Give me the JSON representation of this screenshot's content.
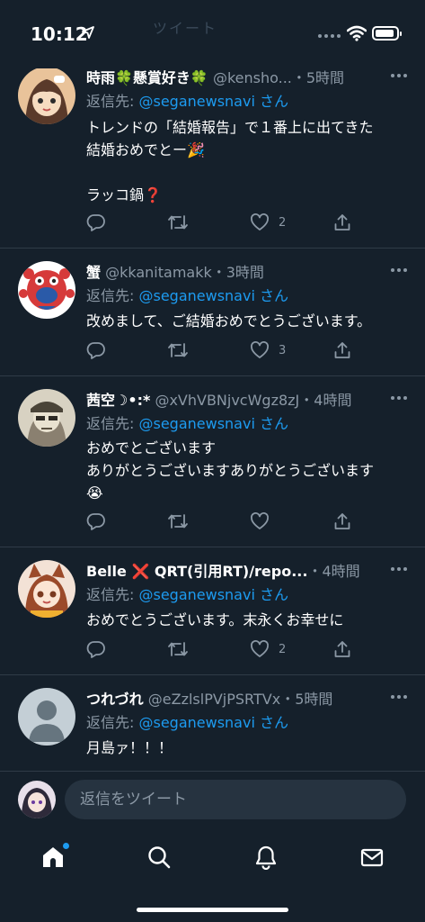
{
  "status_bar": {
    "time": "10:12",
    "ghost_text": "ツイート"
  },
  "tweets": [
    {
      "name": "時雨🍀懸賞好き🍀",
      "handle": "@kensho...",
      "time": "・5時間",
      "reply_prefix": "返信先: ",
      "reply_to": "@seganewsnavi",
      "reply_suffix": " さん",
      "text": "トレンドの「結婚報告」で１番上に出てきた\n結婚おめでとー🎉\n\nラッコ鍋❓",
      "likes": "2"
    },
    {
      "name": "蟹",
      "handle": "@kkanitamakk",
      "time": "・3時間",
      "reply_prefix": "返信先: ",
      "reply_to": "@seganewsnavi",
      "reply_suffix": " さん",
      "text": "改めまして、ご結婚おめでとうございます。",
      "likes": "3"
    },
    {
      "name": "茜空☽•:*",
      "handle": "@xVhVBNjvcWgz8zJ",
      "time": "・4時間",
      "reply_prefix": "返信先: ",
      "reply_to": "@seganewsnavi",
      "reply_suffix": " さん",
      "text": "おめでとございます\nありがとうございますありがとうございます\n😭",
      "likes": ""
    },
    {
      "name": "Belle ❌ QRT(引用RT)/repo...",
      "handle": "",
      "time": "・4時間",
      "reply_prefix": "返信先: ",
      "reply_to": "@seganewsnavi",
      "reply_suffix": " さん",
      "text": "おめでとうございます。末永くお幸せに",
      "likes": "2"
    },
    {
      "name": "つれづれ",
      "handle": "@eZzlslPVjPSRTVx",
      "time": "・5時間",
      "reply_prefix": "返信先: ",
      "reply_to": "@seganewsnavi",
      "reply_suffix": " さん",
      "text": "月島ァ！！！",
      "likes": ""
    }
  ],
  "reply_bar": {
    "placeholder": "返信をツイート"
  },
  "tabbar": {
    "items": [
      "home-icon",
      "search-icon",
      "bell-icon",
      "mail-icon"
    ]
  },
  "colors": {
    "background": "#15202b",
    "accent": "#1d9bf0",
    "muted": "#8b98a5"
  }
}
